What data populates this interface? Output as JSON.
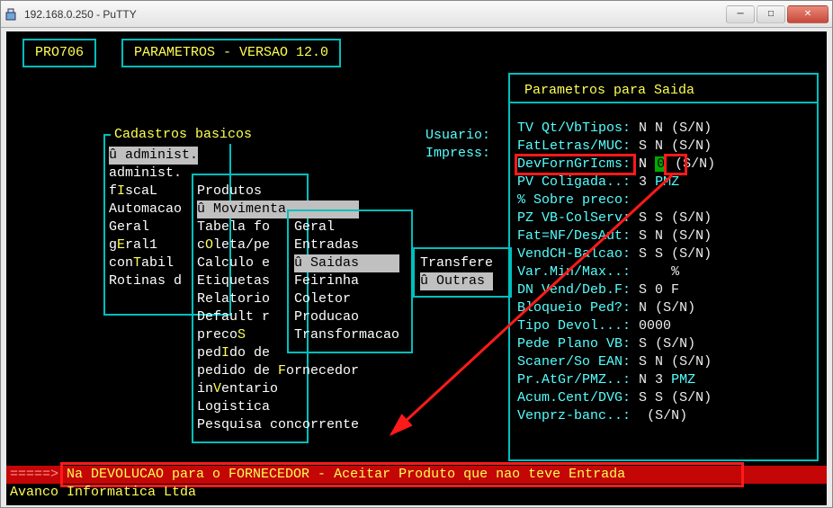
{
  "window": {
    "title": "192.168.0.250 - PuTTY"
  },
  "header": {
    "code": "PRO706",
    "title": "PARAMETROS - VERSAO 12.0"
  },
  "labels": {
    "usuario": "Usuario:",
    "impress": "Impress:"
  },
  "menu1": {
    "title": "Cadastros basicos",
    "items": [
      "û administ.",
      "administ.",
      "fIscaL",
      "Automacao",
      "Geral",
      "gEral1",
      "conTabil",
      "Rotinas d"
    ],
    "selected_index": 0
  },
  "menu2": {
    "items": [
      "Produtos",
      "û Movimenta",
      "Tabela fo",
      "cOleta/pe",
      "Calculo e",
      "Etiquetas",
      "Relatorio",
      "Default r",
      "precoS",
      "pedIdo de",
      "pedido de Fornecedor",
      "inVentario",
      "Logistica",
      "Pesquisa concorrente"
    ],
    "selected_index": 1
  },
  "menu3": {
    "items": [
      "Geral",
      "Entradas",
      "û Saidas",
      "Feirinha",
      "Coletor",
      "Producao",
      "Transformacao"
    ],
    "selected_index": 2
  },
  "menu4": {
    "items": [
      "Transfere",
      "û Outras"
    ],
    "selected_index": 1
  },
  "params": {
    "title": "Parametros para Saida",
    "rows": [
      {
        "label": "TV Qt/VbTipos:",
        "val": "N N",
        "sn": "(S/N)"
      },
      {
        "label": "FatLetras/MUC:",
        "val": "S N",
        "sn": "(S/N)"
      },
      {
        "label": "DevFornGrIcms:",
        "val": "N 0",
        "sn": "(S/N)",
        "hl": true,
        "greencol": 1
      },
      {
        "label": "PV Coligada..:",
        "val": "3",
        "pmz": "PMZ"
      },
      {
        "label": "% Sobre preco:",
        "val": "",
        "sn": ""
      },
      {
        "label": "PZ VB-ColServ:",
        "val": "S S",
        "sn": "(S/N)"
      },
      {
        "label": "Fat=NF/DesAut:",
        "val": "S N",
        "sn": "(S/N)"
      },
      {
        "label": "VendCH-Balcao:",
        "val": "S S",
        "sn": "(S/N)"
      },
      {
        "label": "Var.Min/Max..:",
        "val": "",
        "sn": "   %"
      },
      {
        "label": "DN Vend/Deb.F:",
        "val": "S 0 F",
        "sn": ""
      },
      {
        "label": "Bloqueio Ped?:",
        "val": "N",
        "sn": "(S/N)"
      },
      {
        "label": "Tipo Devol...:",
        "val": "0000",
        "sn": ""
      },
      {
        "label": "Pede Plano VB:",
        "val": "S",
        "sn": "(S/N)"
      },
      {
        "label": "Scaner/So EAN:",
        "val": "S N",
        "sn": "(S/N)"
      },
      {
        "label": "Pr.AtGr/PMZ..:",
        "val": "N 3",
        "pmz": "PMZ"
      },
      {
        "label": "Acum.Cent/DVG:",
        "val": "S S",
        "sn": "(S/N)"
      },
      {
        "label": "Venprz-banc..:",
        "val": "",
        "sn": "(S/N)"
      }
    ]
  },
  "status": {
    "prefix": "=====> ",
    "text": "Na DEVOLUCAO para o FORNECEDOR - Aceitar Produto que nao teve Entrada"
  },
  "footer": "Avanco Informatica Ltda"
}
